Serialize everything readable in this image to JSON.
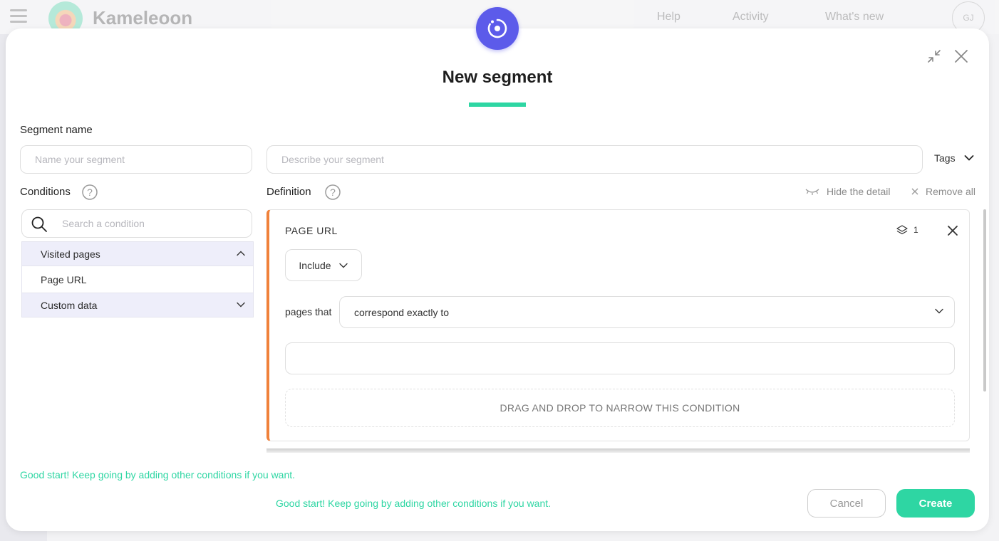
{
  "background": {
    "brand": "Kameleoon",
    "nav": [
      "Help",
      "Activity",
      "What's new"
    ],
    "avatar": "GJ"
  },
  "modal": {
    "title": "New segment",
    "accent_color": "#2ed6a3",
    "badge_color": "#5c5bea"
  },
  "form": {
    "segment_name_label": "Segment name",
    "name_placeholder": "Name your segment",
    "name_value": "",
    "description_placeholder": "Describe your segment",
    "description_value": "",
    "tags_label": "Tags"
  },
  "conditions": {
    "label": "Conditions",
    "search_placeholder": "Search a condition",
    "groups": [
      {
        "label": "Visited pages",
        "expanded": true,
        "items": [
          "Page URL"
        ]
      },
      {
        "label": "Custom data",
        "expanded": false,
        "items": []
      }
    ]
  },
  "definition": {
    "label": "Definition",
    "hide_detail": "Hide the detail",
    "remove_all": "Remove all",
    "card": {
      "title": "PAGE URL",
      "count": "1",
      "border_color": "#f0813a",
      "include_label": "Include",
      "pages_that_label": "pages that",
      "match_value": "correspond exactly to",
      "url_value": "",
      "dropzone_text": "DRAG AND DROP TO NARROW THIS CONDITION"
    }
  },
  "footer": {
    "hint_left": "Good start! Keep going by adding other conditions if you want.",
    "hint_center": "Good start! Keep going by adding other conditions if you want.",
    "cancel_label": "Cancel",
    "create_label": "Create"
  }
}
